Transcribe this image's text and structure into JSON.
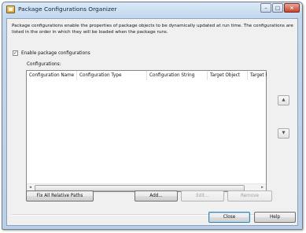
{
  "window": {
    "title": "Package Configurations Organizer",
    "minimize_label": "–",
    "maximize_label": "□",
    "close_label": "×"
  },
  "description": "Package configurations enable the properties of package objects to be dynamically updated at run time. The configurations are listed in the order in which they will be loaded when the package runs.",
  "enable_checkbox": {
    "label": "Enable package configurations",
    "checked": true,
    "mark": "✓"
  },
  "configurations": {
    "label": "Configurations:",
    "columns": [
      "Configuration Name",
      "Configuration Type",
      "Configuration String",
      "Target Object",
      "Target Pro"
    ],
    "rows": [],
    "scroll_left": "◂",
    "scroll_right": "▸"
  },
  "move_up_icon": "▲",
  "move_down_icon": "▼",
  "buttons": {
    "fix_paths": "Fix All Relative Paths",
    "add": "Add...",
    "edit": "Edit...",
    "remove": "Remove",
    "close": "Close",
    "help": "Help"
  }
}
